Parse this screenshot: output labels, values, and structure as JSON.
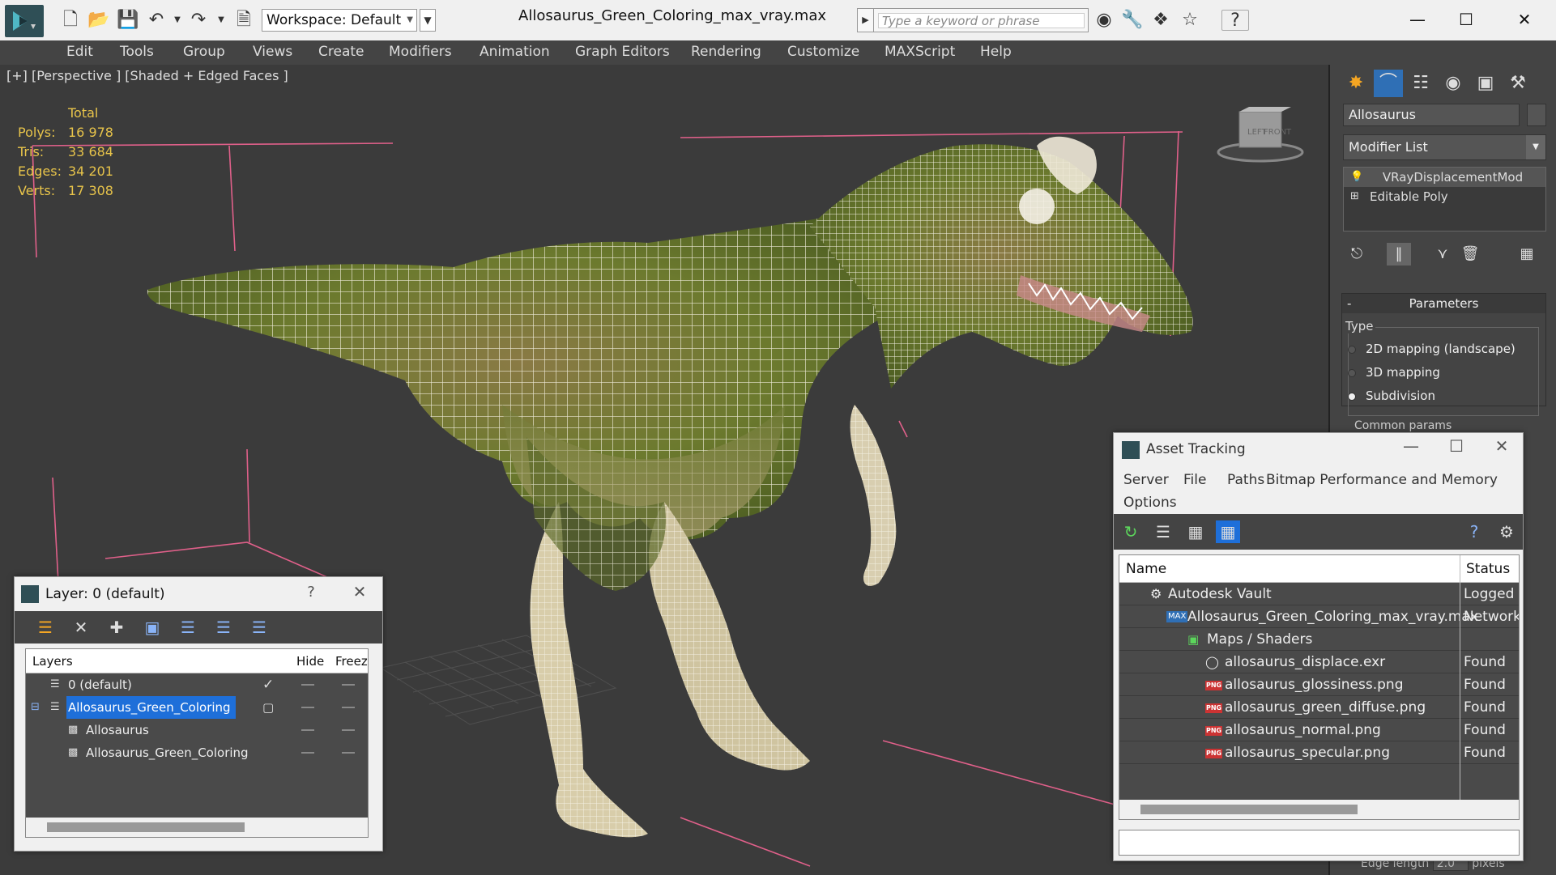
{
  "titlebar": {
    "workspace": "Workspace: Default",
    "document_title": "Allosaurus_Green_Coloring_max_vray.max",
    "search_placeholder": "Type a keyword or phrase"
  },
  "menubar": {
    "items": [
      "Edit",
      "Tools",
      "Group",
      "Views",
      "Create",
      "Modifiers",
      "Animation",
      "Graph Editors",
      "Rendering",
      "Customize",
      "MAXScript",
      "Help"
    ]
  },
  "viewport": {
    "label": "[+] [Perspective ] [Shaded + Edged Faces ]",
    "stats": {
      "header": "Total",
      "rows": [
        {
          "key": "Polys:",
          "value": "16 978"
        },
        {
          "key": "Tris:",
          "value": "33 684"
        },
        {
          "key": "Edges:",
          "value": "34 201"
        },
        {
          "key": "Verts:",
          "value": "17 308"
        }
      ]
    },
    "viewcube_labels": [
      "LEFT",
      "FRONT"
    ]
  },
  "command_panel": {
    "object_name": "Allosaurus",
    "modifier_list": "Modifier List",
    "stack": [
      "VRayDisplacementMod",
      "Editable Poly"
    ],
    "rollout_title": "Parameters",
    "type_label": "Type",
    "options": [
      {
        "label": "2D mapping (landscape)",
        "selected": false
      },
      {
        "label": "3D mapping",
        "selected": false
      },
      {
        "label": "Subdivision",
        "selected": true
      }
    ],
    "common_params": "Common params",
    "edge_length_label": "Edge length",
    "edge_length_value": "2.0",
    "edge_length_unit": "pixels"
  },
  "layer_window": {
    "title": "Layer: 0 (default)",
    "help": "?",
    "columns": [
      "Layers",
      "Hide",
      "Freez"
    ],
    "rows": [
      {
        "name": "0 (default)",
        "indent": 0,
        "selected": false,
        "current": true
      },
      {
        "name": "Allosaurus_Green_Coloring",
        "indent": 0,
        "selected": true,
        "current": false
      },
      {
        "name": "Allosaurus",
        "indent": 1,
        "selected": false,
        "current": false
      },
      {
        "name": "Allosaurus_Green_Coloring",
        "indent": 1,
        "selected": false,
        "current": false
      }
    ]
  },
  "asset_window": {
    "title": "Asset Tracking",
    "menus": [
      "Server",
      "File",
      "Paths",
      "Bitmap Performance and Memory",
      "Options"
    ],
    "columns": [
      "Name",
      "Status"
    ],
    "rows": [
      {
        "name": "Autodesk Vault",
        "status": "Logged",
        "indent": 0,
        "icon": "vault"
      },
      {
        "name": "Allosaurus_Green_Coloring_max_vray.max",
        "status": "Network",
        "indent": 1,
        "icon": "max"
      },
      {
        "name": "Maps / Shaders",
        "status": "",
        "indent": 2,
        "icon": "maps"
      },
      {
        "name": "allosaurus_displace.exr",
        "status": "Found",
        "indent": 3,
        "icon": "exr"
      },
      {
        "name": "allosaurus_glossiness.png",
        "status": "Found",
        "indent": 3,
        "icon": "png"
      },
      {
        "name": "allosaurus_green_diffuse.png",
        "status": "Found",
        "indent": 3,
        "icon": "png"
      },
      {
        "name": "allosaurus_normal.png",
        "status": "Found",
        "indent": 3,
        "icon": "png"
      },
      {
        "name": "allosaurus_specular.png",
        "status": "Found",
        "indent": 3,
        "icon": "png"
      }
    ]
  },
  "colors": {
    "accent": "#1e6fd9",
    "stats_text": "#e8c44a",
    "viewport_bg": "#3b3b3b",
    "panel_bg": "#444444",
    "mesh_wire": "#f2eedd",
    "mesh_skin": "#7d8a3a",
    "bbox_pink": "#e0608a"
  }
}
